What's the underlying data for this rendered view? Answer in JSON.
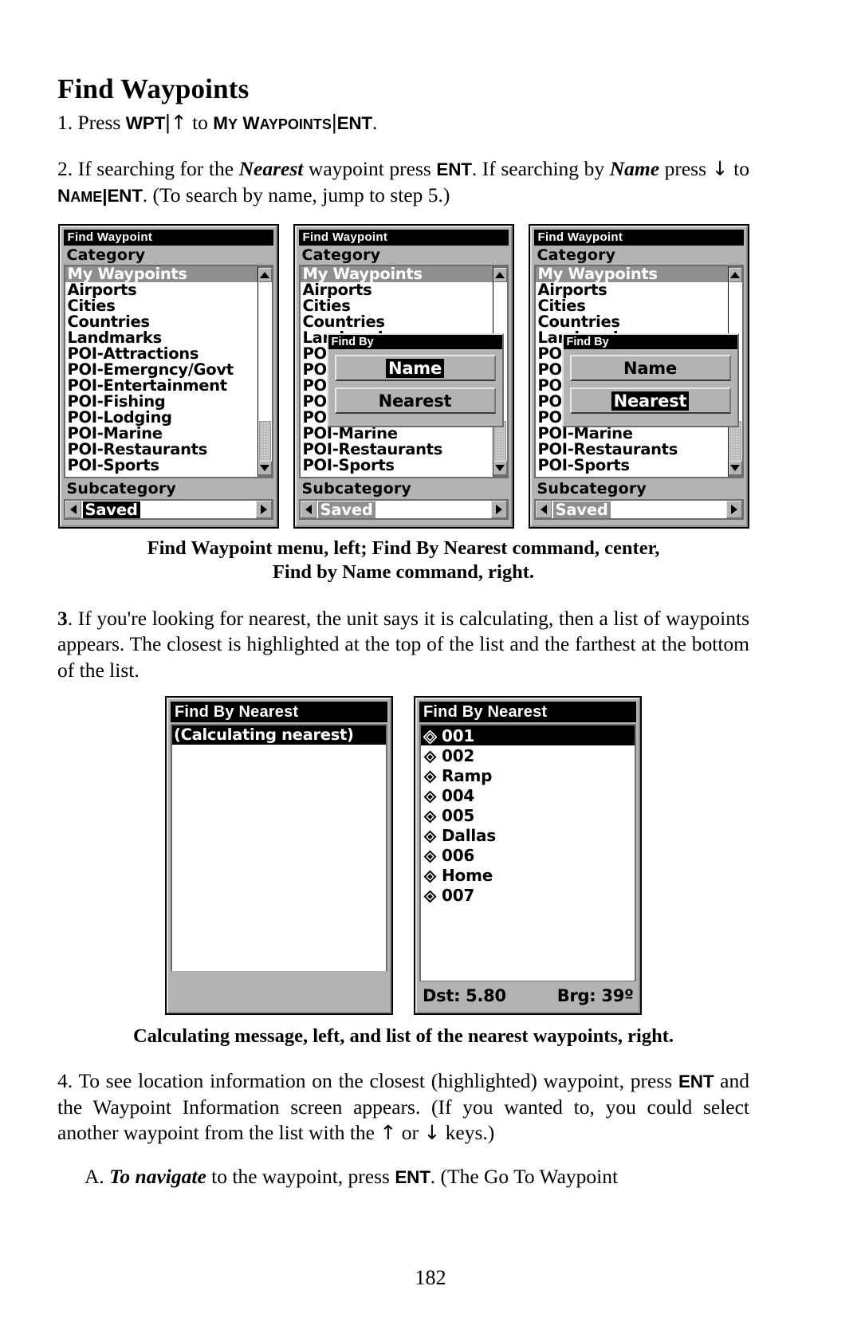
{
  "page": {
    "title": "Find Waypoints",
    "number": "182"
  },
  "steps": {
    "step1": {
      "num": "1. ",
      "press": "Press ",
      "key_wpt": "WPT",
      "sep1": "|",
      "arrow_up": "↑",
      "to": " to ",
      "my_waypoints_cap1": "M",
      "my_waypoints_low1": "Y",
      "my_waypoints_space": " ",
      "my_waypoints_cap2": "W",
      "my_waypoints_low2": "AYPOINTS",
      "sep2": "|",
      "key_ent": "ENT",
      "period": "."
    },
    "step2": {
      "text_a": "2. If searching for the ",
      "nearest": "Nearest",
      "text_b": " waypoint press ",
      "key_ent1": "ENT",
      "text_c": ". If searching by ",
      "name": "Name",
      "text_d": " press ",
      "arrow_down": "↓",
      "text_e": " to ",
      "name_cap": "N",
      "name_low": "AME",
      "sep": "|",
      "key_ent2": "ENT",
      "text_f": ". (To search by name, jump to step 5.)"
    },
    "step3": "3. If you're looking for nearest, the unit says it is calculating, then a list of waypoints appears. The closest is highlighted at the top of the list and the farthest at the bottom of the list.",
    "step3_lead": "3",
    "step3_rest": ". If you're looking for nearest, the unit says it is calculating, then a list of waypoints appears. The closest is highlighted at the top of the list and the farthest at the bottom of the list.",
    "step4": {
      "text_a": "4. To see location information on the closest (highlighted) waypoint, press ",
      "key_ent": "ENT",
      "text_b": " and the Waypoint Information screen appears. (If you wanted to, you could select another waypoint from the list with the ",
      "arrow_up": "↑",
      "text_c": " or ",
      "arrow_down": "↓",
      "text_d": " keys.)"
    },
    "step4a": {
      "letter": "A. ",
      "to_navigate": "To navigate",
      "text_a": " to the waypoint, press ",
      "key_ent": "ENT",
      "text_b": ". (The Go To Waypoint"
    }
  },
  "captions": {
    "figure1_line1": "Find Waypoint menu, left; Find By Nearest command, center,",
    "figure1_line2": "Find by Name command, right.",
    "figure2": "Calculating message, left, and list of the nearest waypoints, right."
  },
  "find_waypoint_screen": {
    "title": "Find Waypoint",
    "category_label": "Category",
    "subcategory_label": "Subcategory",
    "subcategory_value": "Saved",
    "categories": [
      "My Waypoints",
      "Airports",
      "Cities",
      "Countries",
      "Landmarks",
      "POI-Attractions",
      "POI-Emergncy/Govt",
      "POI-Entertainment",
      "POI-Fishing",
      "POI-Lodging",
      "POI-Marine",
      "POI-Restaurants",
      "POI-Sports"
    ],
    "selected_category": "My Waypoints"
  },
  "find_by_dialog": {
    "title": "Find By",
    "options": [
      "Name",
      "Nearest"
    ],
    "center_selected": "Name",
    "right_selected": "Nearest"
  },
  "find_by_nearest_calculating": {
    "title": "Find By Nearest",
    "message": "(Calculating nearest)"
  },
  "find_by_nearest_list": {
    "title": "Find By Nearest",
    "waypoints": [
      "001",
      "002",
      "Ramp",
      "004",
      "005",
      "Dallas",
      "006",
      "Home",
      "007"
    ],
    "selected_waypoint": "001",
    "distance_label": "Dst: 5.80",
    "bearing_label": "Brg: 39º"
  },
  "colors": {
    "screen_bg": "#b3b3b3",
    "list_bg": "#ffffff",
    "highlight_bg": "#000000",
    "highlight_gray": "#8f8f8f",
    "text": "#000000"
  }
}
